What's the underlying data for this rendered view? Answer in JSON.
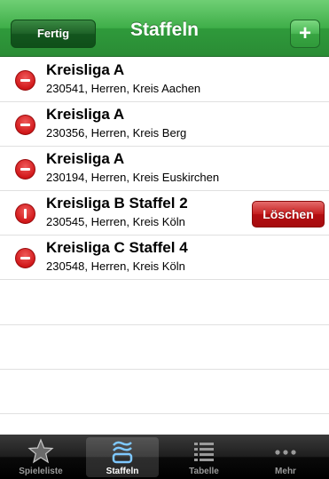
{
  "navbar": {
    "title": "Staffeln",
    "done_label": "Fertig",
    "add_label": "+"
  },
  "list": {
    "items": [
      {
        "title": "Kreisliga A",
        "subtitle": "230541, Herren, Kreis Aachen",
        "delete_icon": "minus-circle-icon"
      },
      {
        "title": "Kreisliga A",
        "subtitle": "230356, Herren, Kreis Berg",
        "delete_icon": "minus-circle-icon"
      },
      {
        "title": "Kreisliga A",
        "subtitle": "230194, Herren, Kreis Euskirchen",
        "delete_icon": "minus-circle-icon"
      },
      {
        "title": "Kreisliga B Staffel 2",
        "subtitle": "230545, Herren, Kreis Köln",
        "delete_icon": "minus-circle-rotated-icon",
        "delete_button": "Löschen"
      },
      {
        "title": "Kreisliga C Staffel 4",
        "subtitle": "230548, Herren, Kreis Köln",
        "delete_icon": "minus-circle-icon"
      }
    ]
  },
  "tabbar": {
    "tabs": [
      {
        "label": "Spieleliste",
        "icon": "star-icon",
        "active": false
      },
      {
        "label": "Staffeln",
        "icon": "staffeln-icon",
        "active": true
      },
      {
        "label": "Tabelle",
        "icon": "list-icon",
        "active": false
      },
      {
        "label": "Mehr",
        "icon": "more-icon",
        "active": false
      }
    ]
  },
  "colors": {
    "navbar_green": "#3fae49",
    "delete_red": "#c51d1d",
    "tab_active_label": "#ffffff",
    "tab_inactive_label": "#9a9a9a"
  }
}
